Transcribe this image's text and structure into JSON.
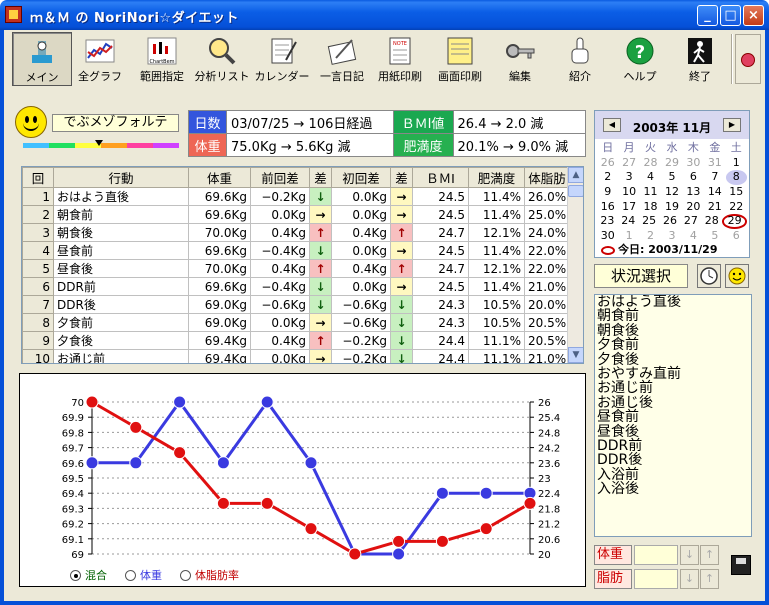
{
  "window": {
    "title": "ｍ＆Ｍ の NoriNori☆ダイエット"
  },
  "toolbar": [
    {
      "label": "メイン"
    },
    {
      "label": "全グラフ"
    },
    {
      "label": "範囲指定"
    },
    {
      "label": "分析リスト"
    },
    {
      "label": "カレンダー"
    },
    {
      "label": "一言日記"
    },
    {
      "label": "用紙印刷"
    },
    {
      "label": "画面印刷"
    },
    {
      "label": "編集"
    },
    {
      "label": "紹介"
    },
    {
      "label": "ヘルプ"
    },
    {
      "label": "終了"
    }
  ],
  "status": {
    "name": "でぶメゾフォルテ",
    "days_label": "日数",
    "days_value": "03/07/25 → 106日経過",
    "bmi_label": "ＢＭI値",
    "bmi_value": "26.4 → 2.0 減",
    "weight_label": "体重",
    "weight_value": "75.0Kg → 5.6Kg 減",
    "fat_label": "肥満度",
    "fat_value": "20.1% → 9.0% 減"
  },
  "grid": {
    "headers": [
      "回",
      "行動",
      "体重",
      "前回差",
      "差",
      "初回差",
      "差",
      "ＢＭI",
      "肥満度",
      "体脂肪"
    ],
    "rows": [
      [
        "1",
        "おはよう直後",
        "69.6Kg",
        "−0.2Kg",
        "↓",
        "0.0Kg",
        "→",
        "24.5",
        "11.4%",
        "26.0%"
      ],
      [
        "2",
        "朝食前",
        "69.6Kg",
        "0.0Kg",
        "→",
        "0.0Kg",
        "→",
        "24.5",
        "11.4%",
        "25.0%"
      ],
      [
        "3",
        "朝食後",
        "70.0Kg",
        "0.4Kg",
        "↑",
        "0.4Kg",
        "↑",
        "24.7",
        "12.1%",
        "24.0%"
      ],
      [
        "4",
        "昼食前",
        "69.6Kg",
        "−0.4Kg",
        "↓",
        "0.0Kg",
        "→",
        "24.5",
        "11.4%",
        "22.0%"
      ],
      [
        "5",
        "昼食後",
        "70.0Kg",
        "0.4Kg",
        "↑",
        "0.4Kg",
        "↑",
        "24.7",
        "12.1%",
        "22.0%"
      ],
      [
        "6",
        "DDR前",
        "69.6Kg",
        "−0.4Kg",
        "↓",
        "0.0Kg",
        "→",
        "24.5",
        "11.4%",
        "21.0%"
      ],
      [
        "7",
        "DDR後",
        "69.0Kg",
        "−0.6Kg",
        "↓",
        "−0.6Kg",
        "↓",
        "24.3",
        "10.5%",
        "20.0%"
      ],
      [
        "8",
        "夕食前",
        "69.0Kg",
        "0.0Kg",
        "→",
        "−0.6Kg",
        "↓",
        "24.3",
        "10.5%",
        "20.5%"
      ],
      [
        "9",
        "夕食後",
        "69.4Kg",
        "0.4Kg",
        "↑",
        "−0.2Kg",
        "↓",
        "24.4",
        "11.1%",
        "20.5%"
      ],
      [
        "10",
        "お通じ前",
        "69.4Kg",
        "0.0Kg",
        "→",
        "−0.2Kg",
        "↓",
        "24.4",
        "11.1%",
        "21.0%"
      ]
    ]
  },
  "chart_data": {
    "type": "line",
    "x": [
      1,
      2,
      3,
      4,
      5,
      6,
      7,
      8,
      9,
      10
    ],
    "series": [
      {
        "name": "体重",
        "axis": "left",
        "color": "#3a3ae0",
        "values": [
          69.6,
          69.6,
          70.0,
          69.6,
          70.0,
          69.6,
          69.0,
          69.0,
          69.4,
          69.4,
          69.4
        ]
      },
      {
        "name": "体脂肪率",
        "axis": "right",
        "color": "#e01010",
        "values": [
          26.0,
          25.0,
          24.0,
          22.0,
          22.0,
          21.0,
          20.0,
          20.5,
          20.5,
          21.0,
          22.0
        ]
      }
    ],
    "y_left": {
      "min": 69,
      "max": 70,
      "ticks": [
        "70",
        "69.9",
        "69.8",
        "69.7",
        "69.6",
        "69.5",
        "69.4",
        "69.3",
        "69.2",
        "69.1",
        "69"
      ]
    },
    "y_right": {
      "min": 20,
      "max": 26,
      "ticks": [
        "26",
        "25.4",
        "24.8",
        "24.2",
        "23.6",
        "23",
        "22.4",
        "21.8",
        "21.2",
        "20.6",
        "20"
      ]
    },
    "grid": true,
    "legend": [
      {
        "label": "混合",
        "selected": true,
        "color": "#006000"
      },
      {
        "label": "体重",
        "selected": false,
        "color": "#3a3ae0"
      },
      {
        "label": "体脂肪率",
        "selected": false,
        "color": "#c00000"
      }
    ]
  },
  "calendar": {
    "month_label": "2003年 11月",
    "dow": [
      "日",
      "月",
      "火",
      "水",
      "木",
      "金",
      "土"
    ],
    "weeks": [
      [
        "26",
        "27",
        "28",
        "29",
        "30",
        "31",
        "1"
      ],
      [
        "2",
        "3",
        "4",
        "5",
        "6",
        "7",
        "8"
      ],
      [
        "9",
        "10",
        "11",
        "12",
        "13",
        "14",
        "15"
      ],
      [
        "16",
        "17",
        "18",
        "19",
        "20",
        "21",
        "22"
      ],
      [
        "23",
        "24",
        "25",
        "26",
        "27",
        "28",
        "29"
      ],
      [
        "30",
        "1",
        "2",
        "3",
        "4",
        "5",
        "6"
      ]
    ],
    "today_label": "今日: 2003/11/29"
  },
  "situation": {
    "title": "状況選択",
    "items": [
      "おはよう直後",
      "朝食前",
      "朝食後",
      "夕食前",
      "夕食後",
      "おやすみ直前",
      "お通じ前",
      "お通じ後",
      "昼食前",
      "昼食後",
      "DDR前",
      "DDR後",
      "入浴前",
      "入浴後"
    ]
  },
  "bottom": {
    "weight_label": "体重",
    "fat_label": "脂肪"
  }
}
